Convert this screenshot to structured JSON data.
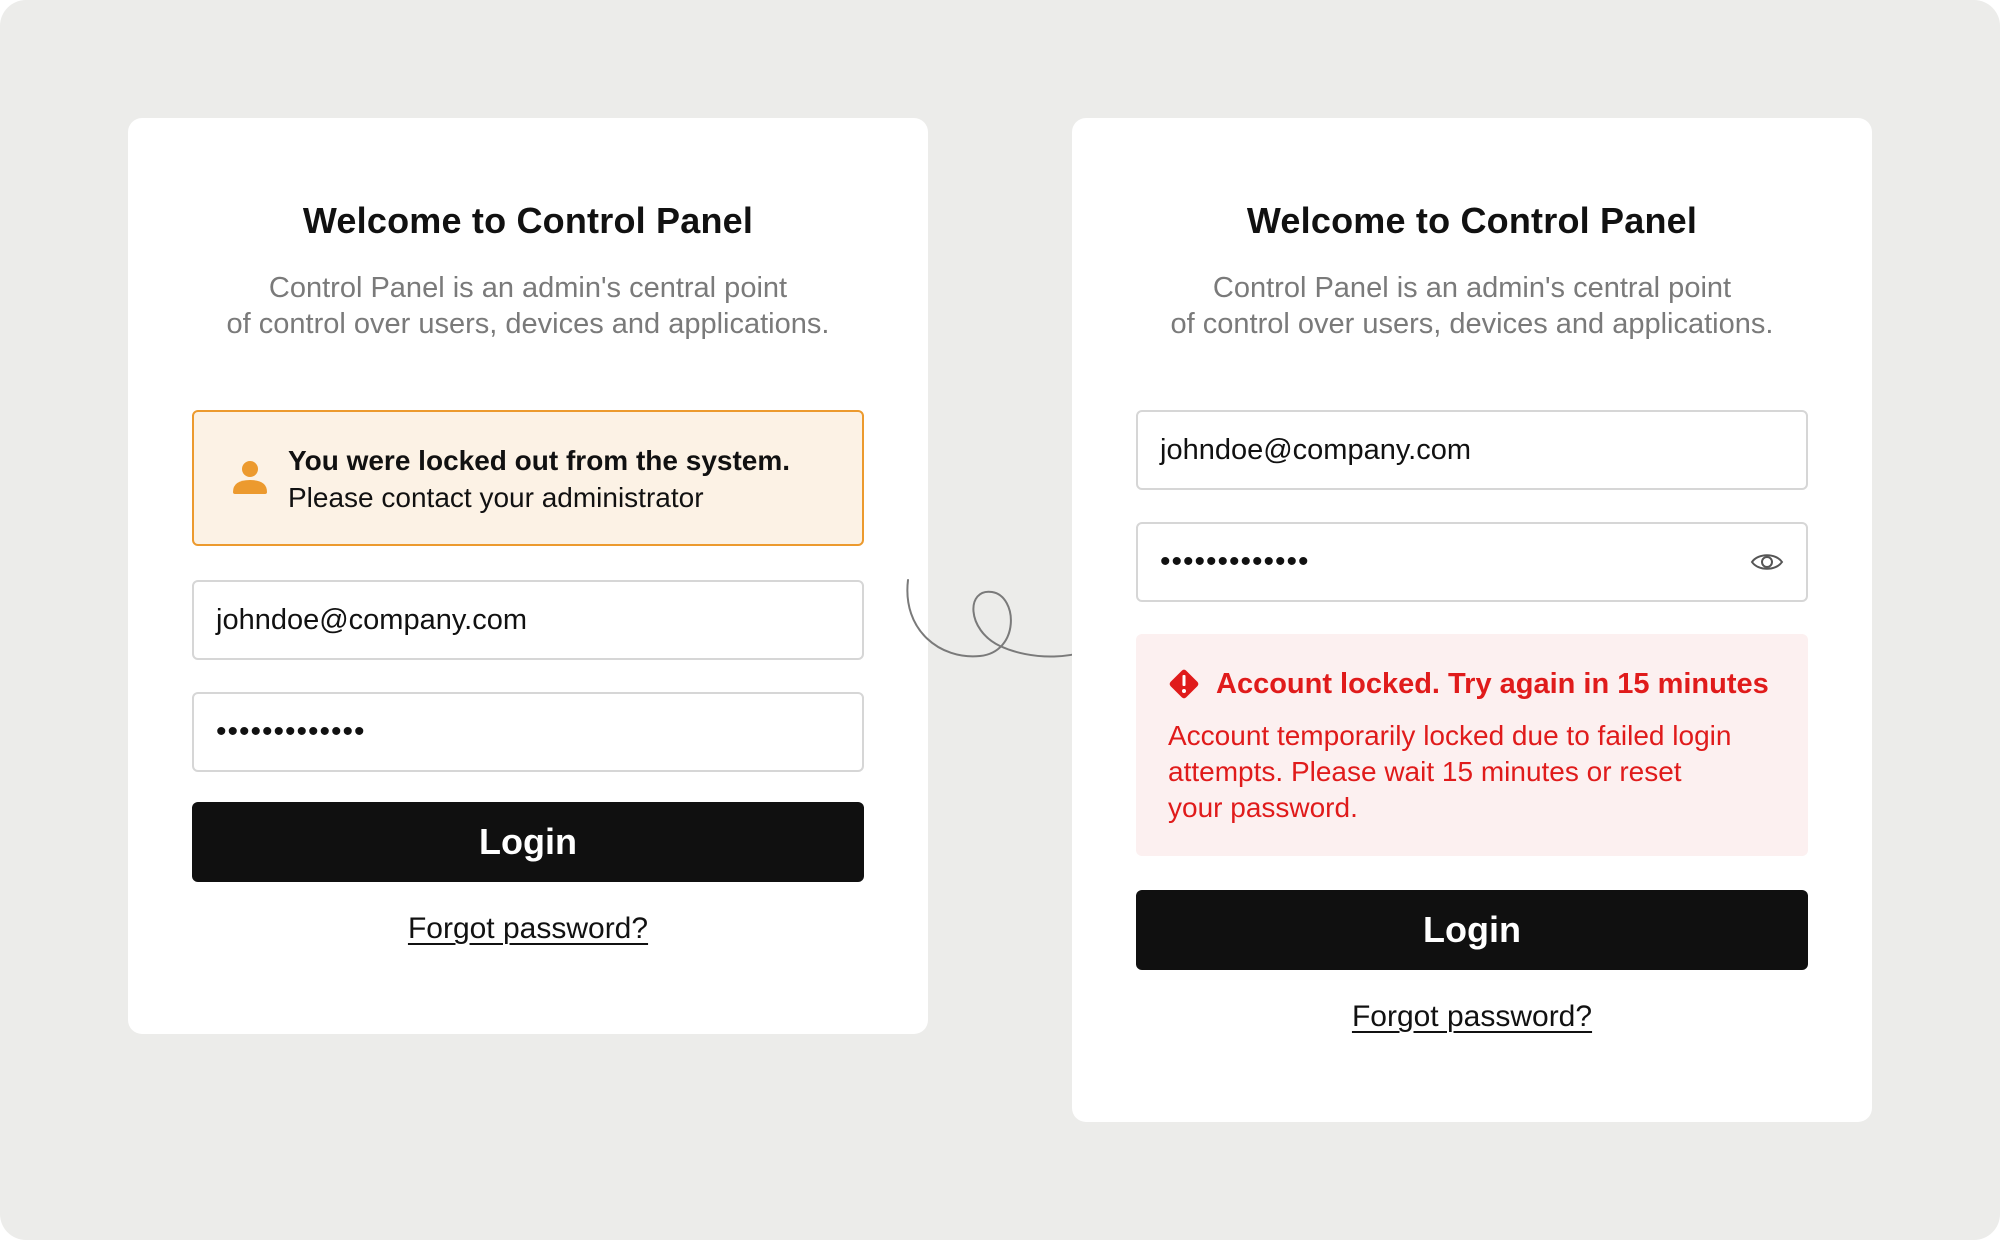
{
  "colors": {
    "background": "#ececea",
    "card": "#ffffff",
    "button": "#101010",
    "warning_border": "#ec9a2e",
    "warning_bg": "#fcf2e5",
    "error_text": "#e01b1b",
    "error_bg": "#fcf0f0"
  },
  "left_card": {
    "title": "Welcome to Control Panel",
    "subtitle_line1": "Control Panel is an admin's central point",
    "subtitle_line2": "of control over users, devices and applications.",
    "notice": {
      "icon": "user-icon",
      "strong": "You were locked out from the system.",
      "text": "Please contact your administrator"
    },
    "email_value": "johndoe@company.com",
    "password_value": "•••••••••••••",
    "login_label": "Login",
    "forgot_label": "Forgot password?"
  },
  "right_card": {
    "title": "Welcome to Control Panel",
    "subtitle_line1": "Control Panel is an admin's central point",
    "subtitle_line2": "of control over users, devices and applications.",
    "email_value": "johndoe@company.com",
    "password_value": "•••••••••••••",
    "password_toggle_icon": "eye-icon",
    "error": {
      "icon": "alert-diamond-icon",
      "title": "Account locked. Try again in 15 minutes",
      "body_line1": "Account temporarily locked due to failed login",
      "body_line2": "attempts. Please wait 15 minutes or reset",
      "body_line3": "your password."
    },
    "login_label": "Login",
    "forgot_label": "Forgot password?"
  },
  "connector": {
    "icon": "curly-arrow-icon"
  }
}
